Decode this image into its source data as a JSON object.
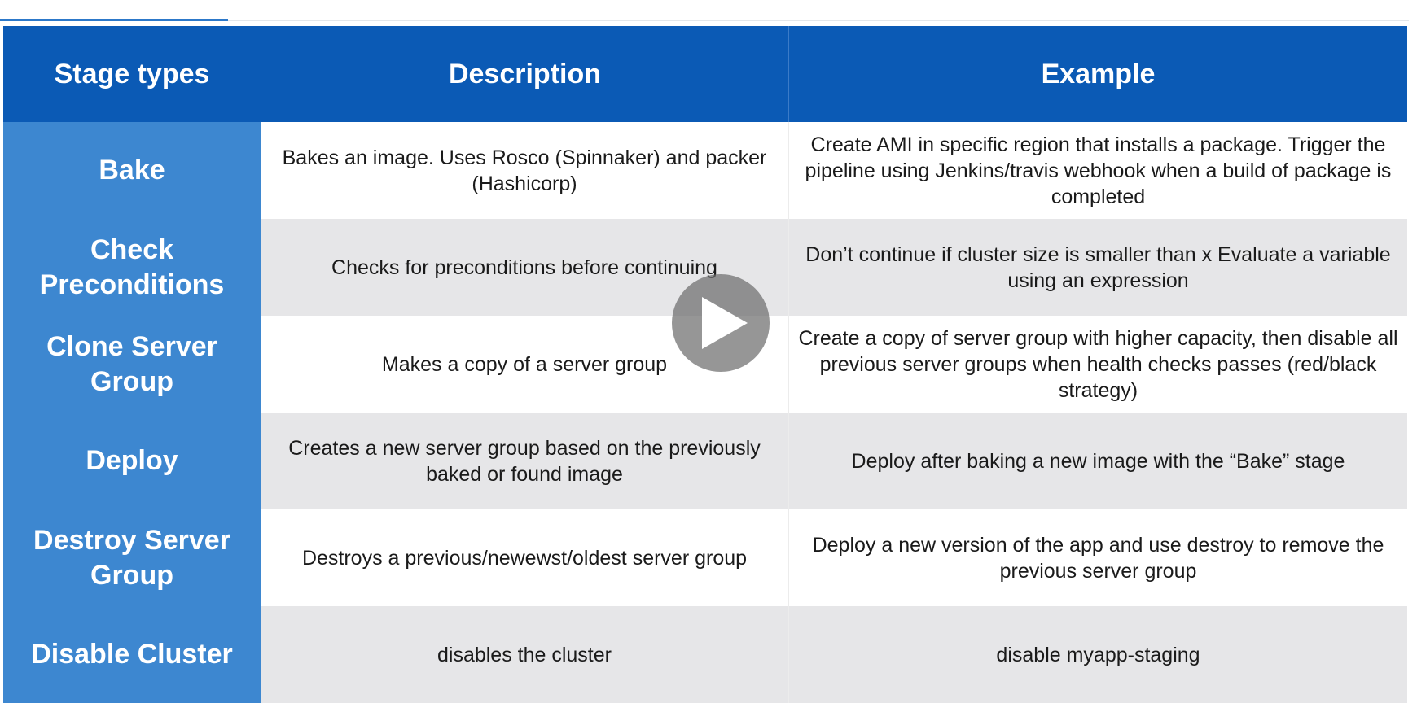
{
  "table": {
    "headers": [
      "Stage types",
      "Description",
      "Example"
    ],
    "rows": [
      {
        "stage": "Bake",
        "description": "Bakes an image. Uses Rosco (Spinnaker) and packer (Hashicorp)",
        "example": "Create AMI in specific region that installs a package. Trigger the pipeline using Jenkins/travis webhook when a build of package is completed"
      },
      {
        "stage": "Check Preconditions",
        "description": "Checks for preconditions before continuing",
        "example": "Don’t continue if cluster size is smaller than x Evaluate a variable using an expression"
      },
      {
        "stage": "Clone Server Group",
        "description": "Makes a copy of a server group",
        "example": "Create a copy of server group with higher capacity, then disable all previous server groups when health checks passes (red/black strategy)"
      },
      {
        "stage": "Deploy",
        "description": "Creates a new server group based on the previously baked or found image",
        "example": "Deploy after baking a new image with the “Bake” stage"
      },
      {
        "stage": "Destroy Server Group",
        "description": "Destroys a previous/newewst/oldest server group",
        "example": "Deploy a new version of the app and use destroy to remove the previous server group"
      },
      {
        "stage": "Disable Cluster",
        "description": "disables the cluster",
        "example": "disable myapp-staging"
      }
    ]
  },
  "player": {
    "icon": "play-icon"
  },
  "colors": {
    "header_bg": "#0b5ab5",
    "stage_bg": "#3d87d0",
    "row_shade": "#e6e6e8",
    "progress": "#2c78c9"
  }
}
